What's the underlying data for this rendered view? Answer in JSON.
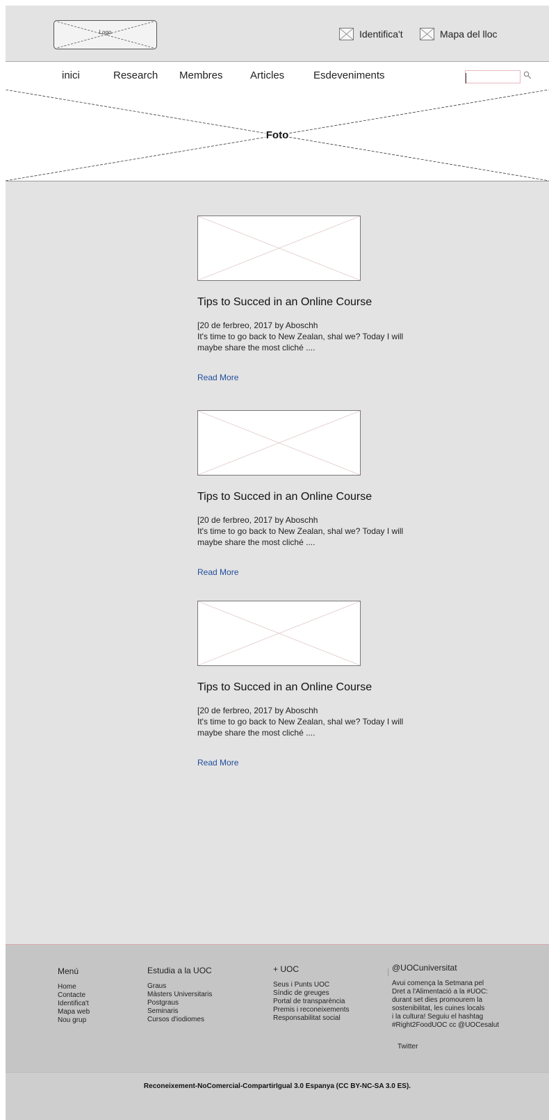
{
  "header": {
    "logo_label": "Logo",
    "login_label": "Identifica't",
    "sitemap_label": "Mapa del lloc"
  },
  "nav": {
    "items": [
      {
        "label": "inici"
      },
      {
        "label": "Research"
      },
      {
        "label": "Membres"
      },
      {
        "label": "Articles"
      },
      {
        "label": "Esdeveniments"
      }
    ],
    "search_placeholder": ""
  },
  "hero": {
    "label": "Foto"
  },
  "posts": [
    {
      "title": "Tips to Succed in an Online Course",
      "meta": "[20 de ferbreo, 2017 by Aboschh",
      "excerpt": "It's time to go back to New Zealan, shal we? Today I will maybe share the most cliché ....",
      "read_more": "Read More"
    },
    {
      "title": "Tips to Succed in an Online Course",
      "meta": "[20 de ferbreo, 2017 by Aboschh",
      "excerpt": "It's time to go back to New Zealan, shal we? Today I will maybe share the most cliché ....",
      "read_more": "Read More"
    },
    {
      "title": "Tips to Succed in an Online Course",
      "meta": "[20 de ferbreo, 2017 by Aboschh",
      "excerpt": "It's time to go back to New Zealan, shal we? Today I will maybe share the most cliché ....",
      "read_more": "Read More"
    }
  ],
  "footer": {
    "menu": {
      "heading": "Menú",
      "items": [
        "Home",
        "Contacte",
        "Identifica't",
        "Mapa web",
        "Nou grup"
      ]
    },
    "study": {
      "heading": "Estudia a la UOC",
      "items": [
        "Graus",
        "Màsters Universitaris",
        "Postgraus",
        "Seminaris",
        "Cursos d'iodiomes"
      ]
    },
    "uoc": {
      "heading": "+ UOC",
      "items": [
        "Seus i Punts UOC",
        "Síndic de greuges",
        "Portal de transparència",
        "Premis i reconeixements",
        "Responsabilitat social"
      ]
    },
    "twitter": {
      "heading": "@UOCuniversitat",
      "tweet_lines": [
        "Avui comença la Setmana pel",
        "Dret a l'Alimentació a la #UOC:",
        "durant set dies promourem la",
        "sostenibilitat, les cuines locals",
        "i la cultura! Seguiu el hashtag",
        "#Right2FoodUOC cc @UOCesalut"
      ],
      "link_label": "Twitter"
    },
    "license": "Reconeixement-NoComercial-CompartirIgual 3.0 Espanya (CC BY-NC-SA 3.0 ES)."
  },
  "colors": {
    "page_bg": "#e4e3e4",
    "footer_bg": "#c6c5c6",
    "link_blue": "#1f4e9a"
  }
}
